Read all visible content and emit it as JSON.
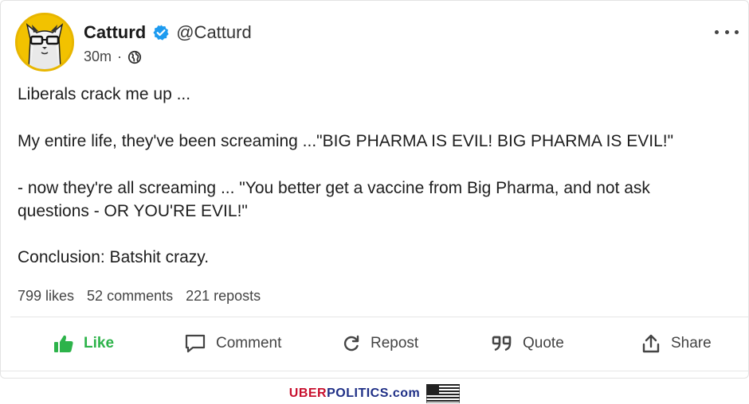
{
  "post": {
    "author_name": "Catturd",
    "author_handle": "@Catturd",
    "time": "30m",
    "separator": "·",
    "avatar_icon": "cat-with-glasses-avatar",
    "verified_icon": "verified-check-icon",
    "visibility_icon": "globe-icon",
    "paragraphs": [
      "Liberals crack me up ...",
      "My entire life, they've been screaming ...\"BIG PHARMA IS EVIL! BIG PHARMA IS EVIL!\"",
      "- now they're all screaming ... \"You better get a vaccine from Big Pharma, and not ask questions - OR YOU'RE EVIL!\"",
      "Conclusion: Batshit crazy."
    ]
  },
  "stats": {
    "likes": "799 likes",
    "comments": "52 comments",
    "reposts": "221 reposts"
  },
  "actions": {
    "like": "Like",
    "comment": "Comment",
    "repost": "Repost",
    "quote": "Quote",
    "share": "Share"
  },
  "watermark": {
    "red_part": "UBER",
    "blue_part": "POLITICS.com",
    "flag_icon": "us-flag-icon"
  },
  "colors": {
    "like_green": "#2db34a",
    "verified_blue": "#1d9bf0",
    "avatar_yellow": "#f2c200",
    "watermark_red": "#c8102e",
    "watermark_blue": "#1f2f86"
  }
}
